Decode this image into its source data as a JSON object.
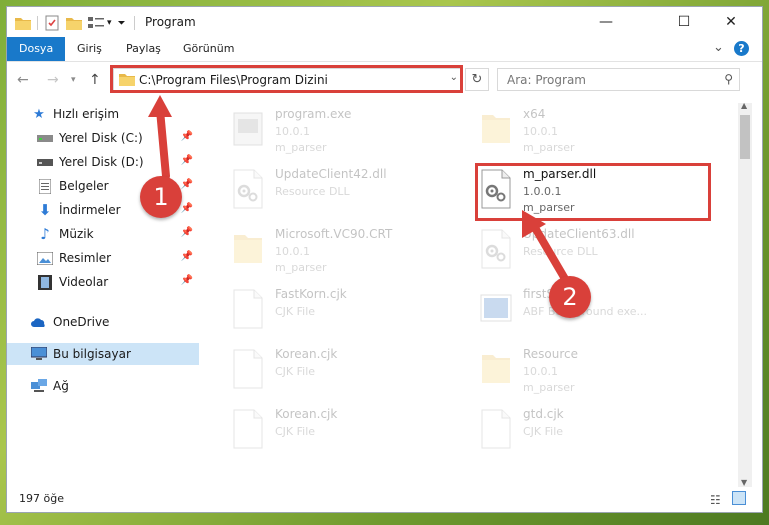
{
  "window": {
    "title": "Program",
    "minimize": "—",
    "maximize": "☐",
    "close": "✕"
  },
  "ribbon": {
    "tabs": [
      "Dosya",
      "Giriş",
      "Paylaş",
      "Görünüm"
    ],
    "active_tab": "Dosya",
    "help": "?",
    "expand": "⌄"
  },
  "address": {
    "path": "C:\\Program Files\\Program Dizini",
    "search_placeholder": "Ara: Program"
  },
  "sidebar": {
    "quick_access": "Hızlı erişim",
    "items": [
      {
        "label": "Yerel Disk (C:)",
        "icon": "drive-icon",
        "pinned": true
      },
      {
        "label": "Yerel Disk (D:)",
        "icon": "drive-icon",
        "pinned": true
      },
      {
        "label": "Belgeler",
        "icon": "documents-icon",
        "pinned": true
      },
      {
        "label": "İndirmeler",
        "icon": "download-icon",
        "pinned": true
      },
      {
        "label": "Müzik",
        "icon": "music-icon",
        "pinned": true
      },
      {
        "label": "Resimler",
        "icon": "pictures-icon",
        "pinned": true
      },
      {
        "label": "Videolar",
        "icon": "video-icon",
        "pinned": true
      }
    ],
    "onedrive": "OneDrive",
    "this_pc": "Bu bilgisayar",
    "network": "Ağ"
  },
  "files": [
    {
      "name": "program.exe",
      "line2": "10.0.1",
      "line3": "m_parser",
      "type": "exe"
    },
    {
      "name": "x64",
      "line2": "10.0.1",
      "line3": "m_parser",
      "type": "folder"
    },
    {
      "name": "UpdateClient42.dll",
      "line2": "Resource DLL",
      "line3": "",
      "type": "dll"
    },
    {
      "name": "m_parser.dll",
      "line2": "1.0.0.1",
      "line3": "m_parser",
      "type": "dll",
      "highlighted": true
    },
    {
      "name": "Microsoft.VC90.CRT",
      "line2": "10.0.1",
      "line3": "m_parser",
      "type": "folder"
    },
    {
      "name": "UpdateClient63.dll",
      "line2": "Resource DLL",
      "line3": "",
      "type": "dll"
    },
    {
      "name": "FastKorn.cjk",
      "line2": "CJK File",
      "line3": "",
      "type": "file"
    },
    {
      "name": "firstScree",
      "line2": "ABF Background exe...",
      "line3": "",
      "type": "image"
    },
    {
      "name": "Korean.cjk",
      "line2": "CJK File",
      "line3": "",
      "type": "file"
    },
    {
      "name": "Resource",
      "line2": "10.0.1",
      "line3": "m_parser",
      "type": "folder"
    },
    {
      "name": "Korean.cjk",
      "line2": "CJK File",
      "line3": "",
      "type": "file"
    },
    {
      "name": "gtd.cjk",
      "line2": "CJK File",
      "line3": "",
      "type": "file"
    }
  ],
  "status": {
    "count": "197 öğe"
  },
  "annotations": {
    "step1": "1",
    "step2": "2",
    "color": "#d9403a"
  }
}
